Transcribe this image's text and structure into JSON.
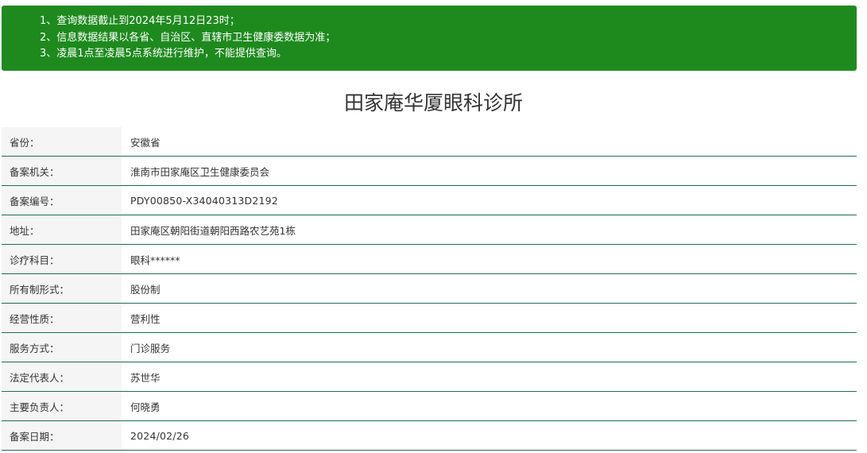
{
  "notice": {
    "lines": [
      "1、查询数据截止到2024年5月12日23时；",
      "2、信息数据结果以各省、自治区、直辖市卫生健康委数据为准；",
      "3、凌晨1点至凌晨5点系统进行维护，不能提供查询。"
    ]
  },
  "title": "田家庵华厦眼科诊所",
  "rows": [
    {
      "label": "省份：",
      "value": "安徽省"
    },
    {
      "label": "备案机关：",
      "value": "淮南市田家庵区卫生健康委员会"
    },
    {
      "label": "备案编号：",
      "value": "PDY00850-X34040313D2192"
    },
    {
      "label": "地址：",
      "value": "田家庵区朝阳街道朝阳西路农艺苑1栋"
    },
    {
      "label": "诊疗科目：",
      "value": "眼科******"
    },
    {
      "label": "所有制形式：",
      "value": "股份制"
    },
    {
      "label": "经营性质：",
      "value": "营利性"
    },
    {
      "label": "服务方式：",
      "value": "门诊服务"
    },
    {
      "label": "法定代表人：",
      "value": "苏世华"
    },
    {
      "label": "主要负责人：",
      "value": "何晓勇"
    },
    {
      "label": "备案日期：",
      "value": "2024/02/26"
    }
  ]
}
